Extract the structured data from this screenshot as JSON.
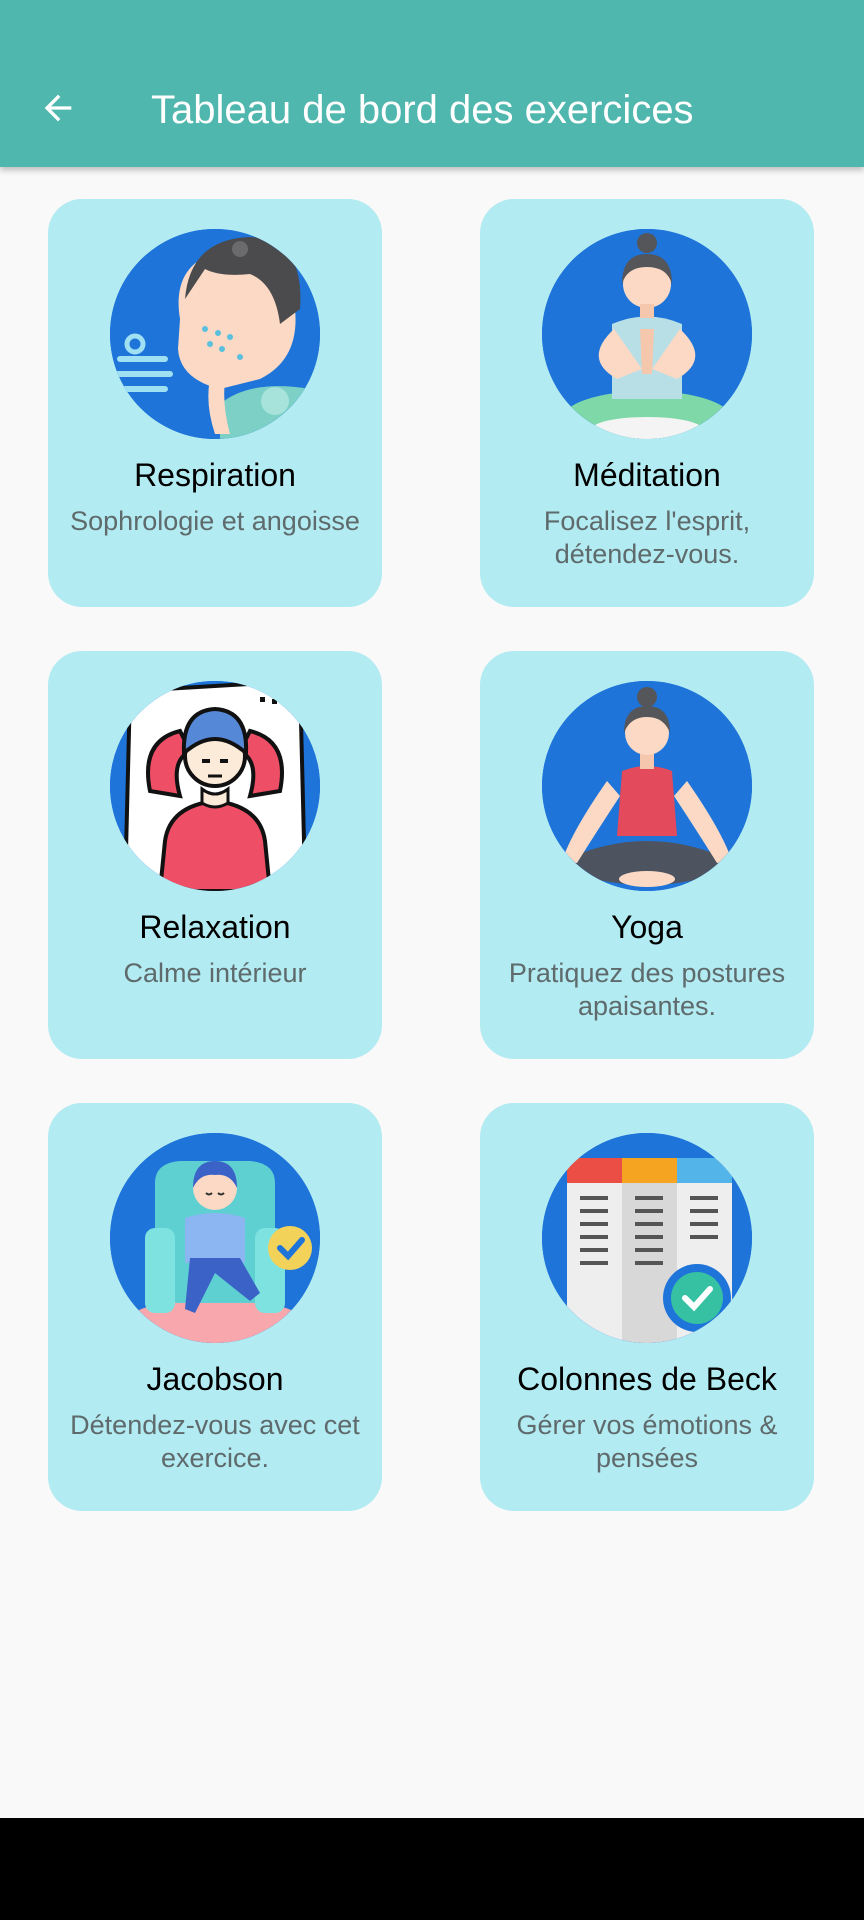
{
  "app_bar": {
    "title": "Tableau de bord des exercices",
    "back_icon": "arrow-left-icon",
    "background": "#50b7ae"
  },
  "cards": [
    {
      "title": "Respiration",
      "subtitle": "Sophrologie et angoisse",
      "icon": "breathing-person-icon"
    },
    {
      "title": "Méditation",
      "subtitle": "Focalisez l'esprit, détendez-vous.",
      "icon": "meditation-woman-icon"
    },
    {
      "title": "Relaxation",
      "subtitle": "Calme intérieur",
      "icon": "relaxing-person-pillow-icon"
    },
    {
      "title": "Yoga",
      "subtitle": "Pratiquez des postures apaisantes.",
      "icon": "yoga-pose-icon"
    },
    {
      "title": "Jacobson",
      "subtitle": "Détendez-vous avec cet exercice.",
      "icon": "person-armchair-icon"
    },
    {
      "title": "Colonnes de Beck",
      "subtitle": "Gérer vos émotions & pensées",
      "icon": "checklist-columns-icon"
    }
  ],
  "colors": {
    "card_background": "#b3ebf2",
    "avatar_background": "#1e74d9",
    "subtitle_text": "#5e6a6b"
  }
}
